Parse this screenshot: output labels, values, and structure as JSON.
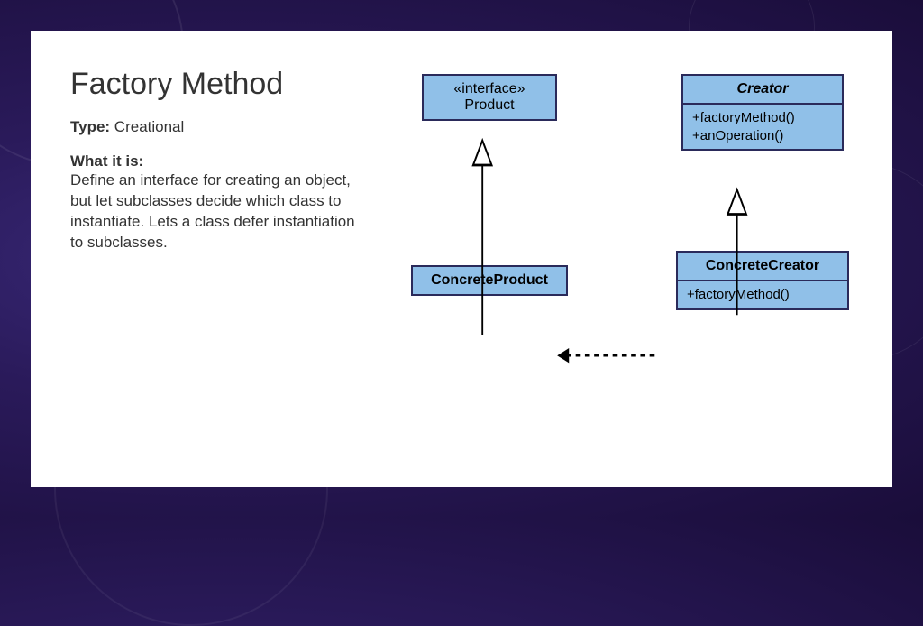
{
  "title": "Factory Method",
  "type_label": "Type:",
  "type_value": " Creational",
  "what_label": "What it is:",
  "description": "Define an interface for creating an object, but let subclasses decide which class to instantiate. Lets a class defer instantiation to subclasses.",
  "uml": {
    "product": {
      "stereotype": "«interface»",
      "name": "Product"
    },
    "creator": {
      "name": "Creator",
      "op1": "+factoryMethod()",
      "op2": "+anOperation()"
    },
    "concreteProduct": {
      "name": "ConcreteProduct"
    },
    "concreteCreator": {
      "name": "ConcreteCreator",
      "op1": "+factoryMethod()"
    }
  }
}
